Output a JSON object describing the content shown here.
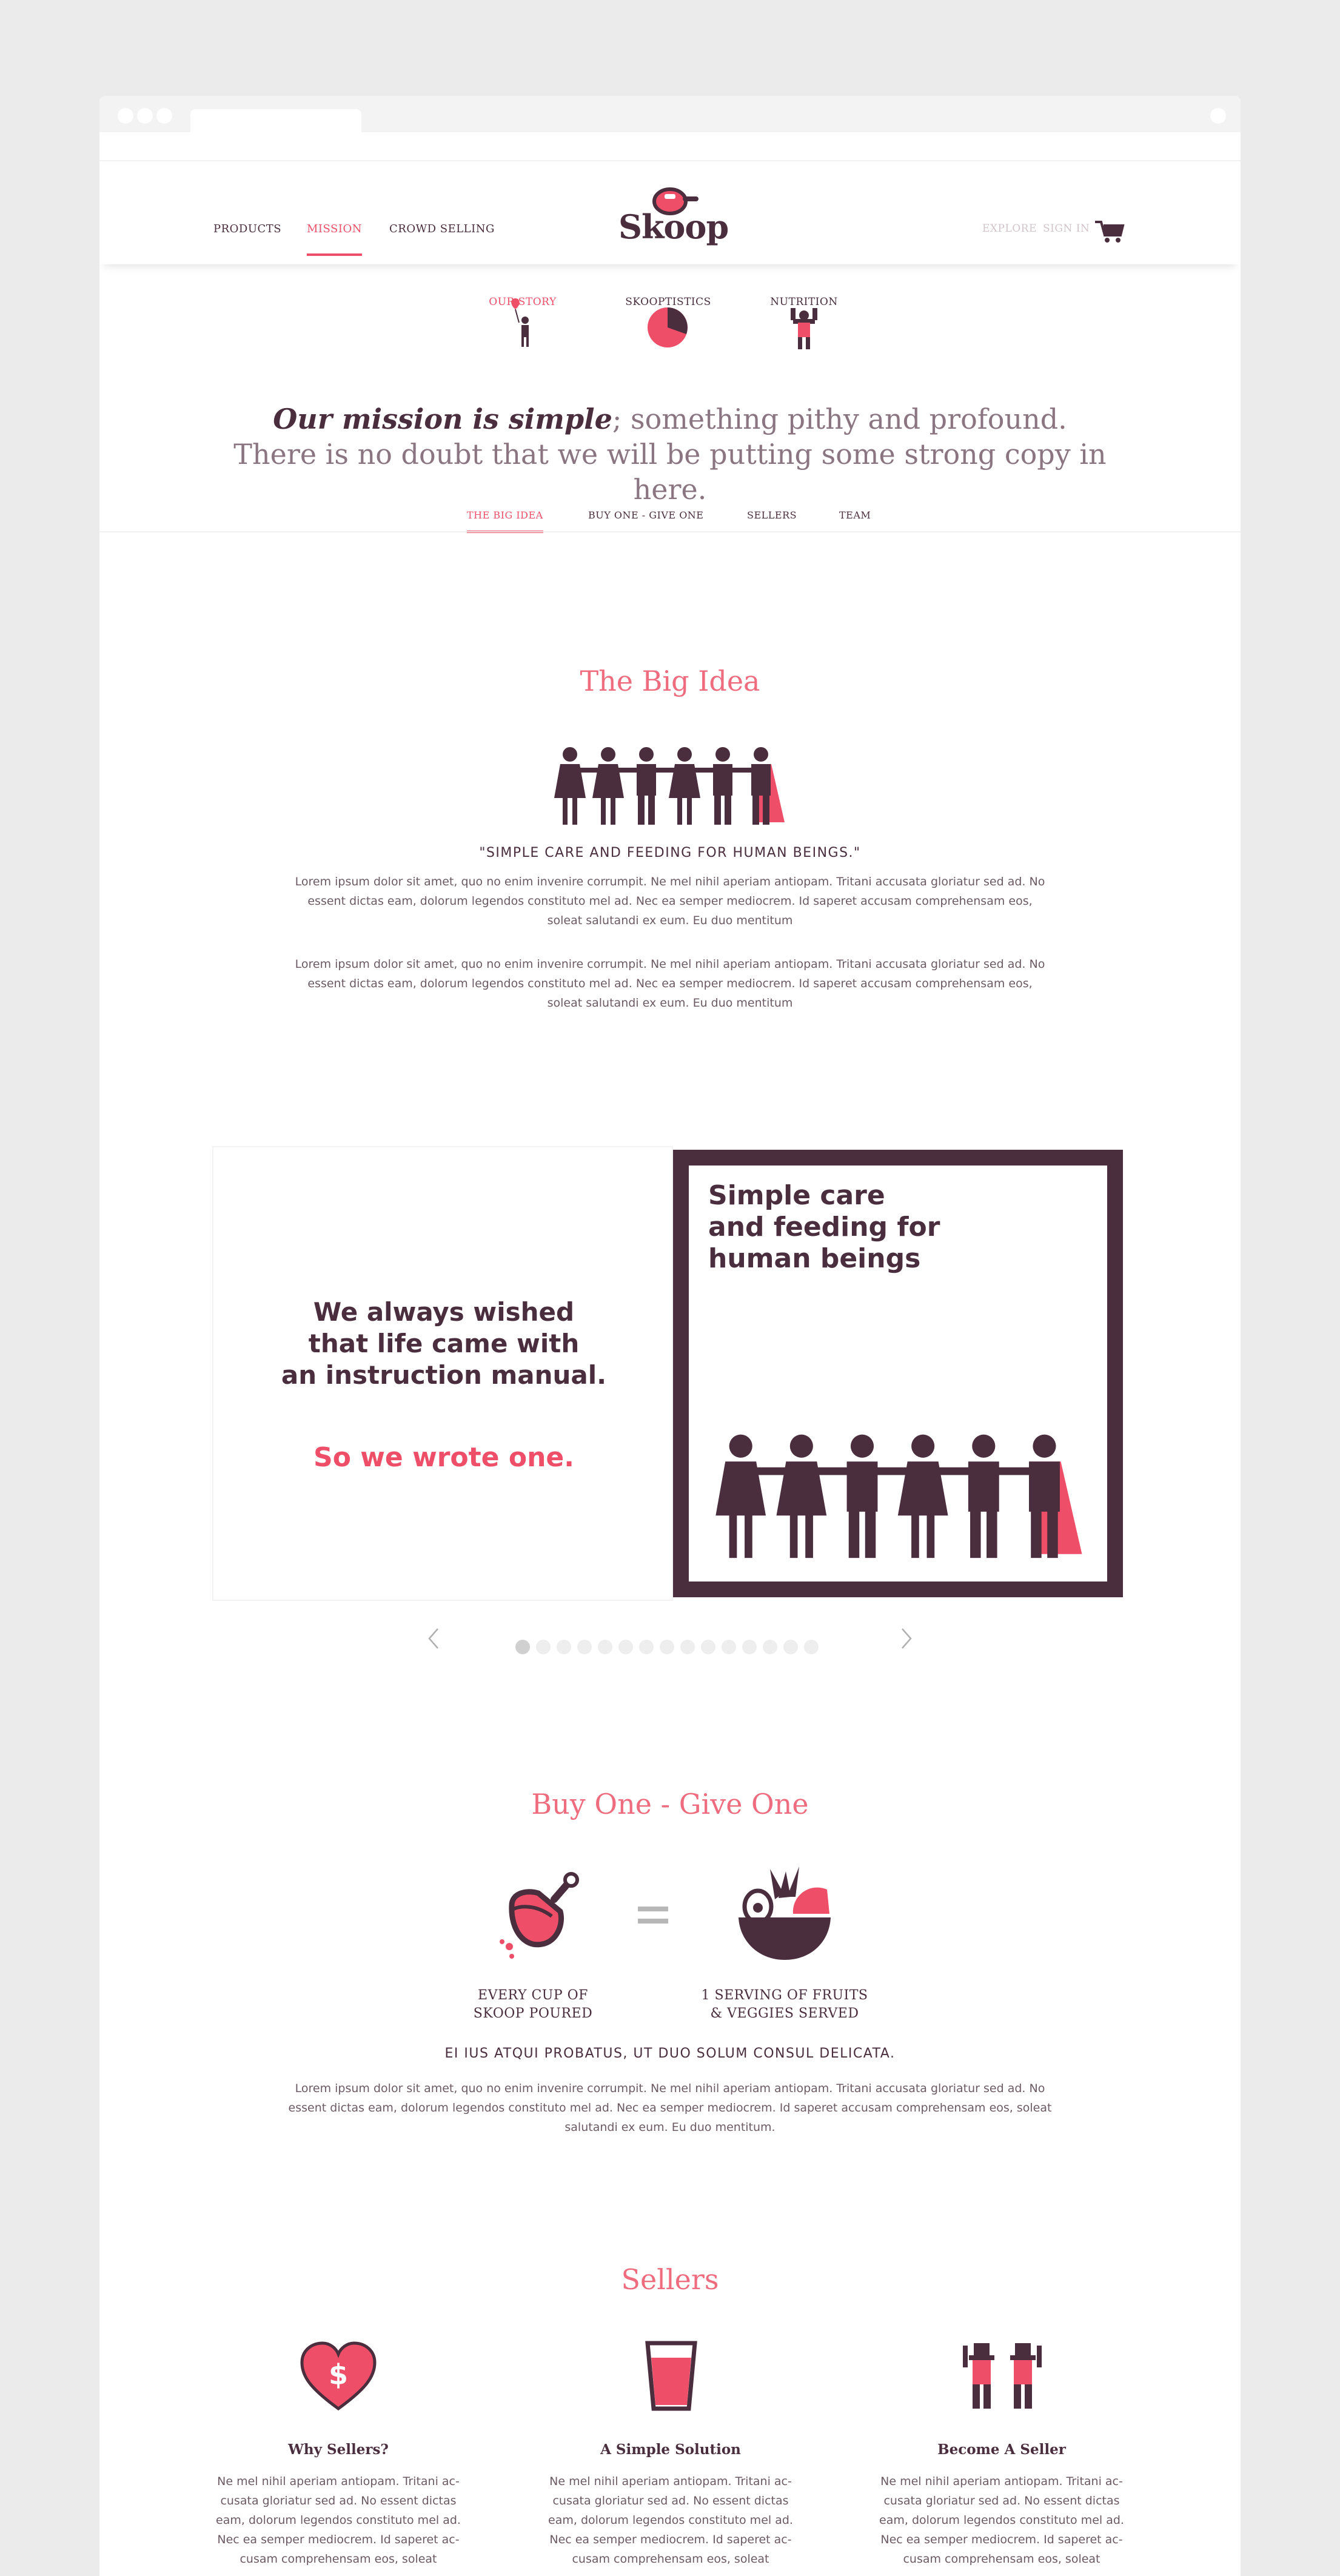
{
  "nav": {
    "left": [
      "PRODUCTS",
      "MISSION",
      "CROWD SELLING"
    ],
    "brand": "Skoop",
    "right": [
      "EXPLORE",
      "SIGN IN"
    ]
  },
  "topics": [
    "OUR STORY",
    "SKOOPTISTICS",
    "NUTRITION"
  ],
  "intro": {
    "emphasis": "Our mission is simple",
    "rest": "; something pithy and profound. There is no doubt that we will be putting some strong copy in here."
  },
  "subnav": [
    "THE BIG IDEA",
    "BUY ONE - GIVE ONE",
    "SELLERS",
    "TEAM"
  ],
  "big_idea": {
    "title": "The Big Idea",
    "quote": "\"SIMPLE CARE AND FEEDING FOR HUMAN BEINGS.\"",
    "para1": "Lorem ipsum dolor sit amet, quo no enim invenire corrumpit. Ne mel nihil aperiam antiopam. Tritani accusata gloriatur sed ad. No essent dictas eam, dolorum legendos constituto mel ad. Nec ea semper mediocrem. Id saperet accusam comprehensam eos, soleat salutandi ex eum. Eu duo mentitum",
    "para2": "Lorem ipsum dolor sit amet, quo no enim invenire corrumpit. Ne mel nihil aperiam antiopam. Tritani accusata gloriatur sed ad. No essent dictas eam, dolorum legendos constituto mel ad. Nec ea semper mediocrem. Id saperet accusam comprehensam eos, soleat salutandi ex eum. Eu duo mentitum"
  },
  "slide": {
    "line1": "We always wished",
    "line2": "that life came with",
    "line3": "an instruction manual.",
    "cta": "So we wrote one.",
    "book1": "Simple care",
    "book2": "and feeding for",
    "book3": "human beings",
    "dot_count": 15,
    "active_dot": 0
  },
  "bogo": {
    "title": "Buy One - Give One",
    "left1": "EVERY CUP  OF",
    "left2": "SKOOP POURED",
    "right1": "1 SERVING OF FRUITS",
    "right2": "& VEGGIES SERVED",
    "quote": "EI IUS ATQUI PROBATUS, UT DUO SOLUM CONSUL DELICATA.",
    "para": "Lorem ipsum dolor sit amet, quo no enim invenire corrumpit. Ne mel nihil aperiam antiopam. Tritani accusata gloriatur sed ad. No essent dictas eam, dolorum legendos constituto mel ad. Nec ea semper mediocrem. Id saperet accusam comprehensam eos, soleat salutandi ex eum. Eu duo mentitum."
  },
  "sellers": {
    "title": "Sellers",
    "cols": [
      {
        "title": "Why Sellers?",
        "text": "Ne mel nihil aperiam antiopam. Tritani ac-cusata gloriatur sed ad. No essent dictas eam, dolorum legendos constituto mel ad. Nec ea semper mediocrem. Id saperet ac-cusam comprehensam eos, soleat"
      },
      {
        "title": "A Simple Solution",
        "text": "Ne mel nihil aperiam antiopam. Tritani ac-cusata gloriatur sed ad. No essent dictas eam, dolorum legendos constituto mel ad. Nec ea semper mediocrem. Id saperet ac-cusam comprehensam eos, soleat"
      },
      {
        "title": "Become A Seller",
        "text": "Ne mel nihil aperiam antiopam. Tritani ac-cusata gloriatur sed ad. No essent dictas eam, dolorum legendos constituto mel ad. Nec ea semper mediocrem. Id saperet ac-cusam comprehensam eos, soleat"
      }
    ]
  },
  "colors": {
    "plum": "#4a2e3d",
    "pink": "#ef4e68",
    "salmon": "#ef6b7e"
  }
}
